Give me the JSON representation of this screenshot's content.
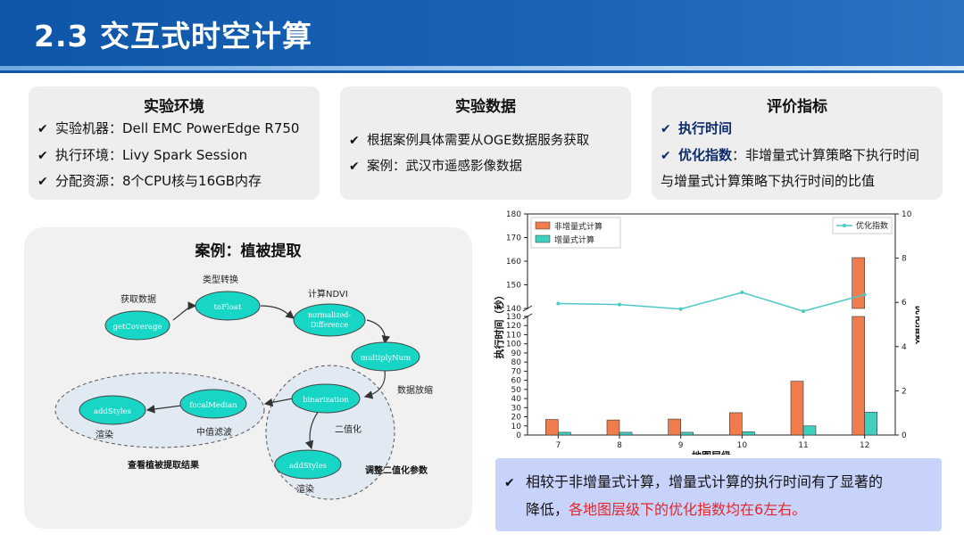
{
  "slide_title": "2.3 交互式时空计算",
  "env": {
    "title": "实验环境",
    "items": [
      "实验机器：Dell EMC PowerEdge R750",
      "执行环境：Livy Spark Session",
      "分配资源：8个CPU核与16GB内存"
    ]
  },
  "data_card": {
    "title": "实验数据",
    "items": [
      "根据案例具体需要从OGE数据服务获取",
      "案例：武汉市遥感影像数据"
    ]
  },
  "metrics": {
    "title": "评价指标",
    "item1": "执行时间",
    "item2_bold": "优化指数",
    "item2_rest": "：非增量式计算策略下执行时间",
    "item2_line2": "与增量式计算策略下执行时间的比值"
  },
  "case": {
    "title": "案例：植被提取",
    "nodes": {
      "getCoverage": "getCoverage",
      "toFloat": "toFloat",
      "nd1": "normalized-",
      "nd2": "Difference",
      "multiplyNum": "multiplyNum",
      "binarization": "binarization",
      "focalMedian": "focalMedian",
      "addStyles1": "addStyles",
      "addStyles2": "addStyles"
    },
    "labels": {
      "get_data": "获取数据",
      "type_convert": "类型转换",
      "ndvi": "计算NDVI",
      "scale": "数据放缩",
      "binarize": "二值化",
      "median": "中值滤波",
      "render1": "渲染",
      "render2": "渲染",
      "view_result": "查看植被提取结果",
      "adjust_param": "调整二值化参数"
    }
  },
  "chart_data": {
    "type": "bar",
    "categories": [
      "7",
      "8",
      "9",
      "10",
      "11",
      "12"
    ],
    "series": [
      {
        "name": "非增量式计算",
        "values": [
          17,
          16.5,
          17.5,
          24.5,
          59,
          161.5
        ],
        "color": "#f07c4d"
      },
      {
        "name": "增量式计算",
        "values": [
          3,
          3,
          3,
          3.5,
          10,
          25
        ],
        "color": "#3fd0c0"
      }
    ],
    "line_series": {
      "name": "优化指数",
      "values": [
        5.95,
        5.9,
        5.7,
        6.45,
        5.6,
        6.35
      ],
      "color": "#4dc9c4",
      "axis": "right"
    },
    "xlabel": "地图层级",
    "ylabel": "执行时间（秒）",
    "y2label": "优化指数",
    "y_ticks_lower": [
      "0",
      "10",
      "20",
      "30",
      "40",
      "50",
      "60",
      "70",
      "80",
      "90",
      "100",
      "110",
      "120",
      "130"
    ],
    "y_ticks_upper": [
      "140",
      "150",
      "160",
      "170",
      "180"
    ],
    "y2_ticks": [
      "0",
      "2",
      "4",
      "6",
      "8",
      "10"
    ],
    "ylim": [
      0,
      180
    ],
    "y_break": [
      130,
      140
    ],
    "y2lim": [
      0,
      10
    ],
    "legend_left": "top-left",
    "legend_right": "top-right"
  },
  "conclusion": {
    "line1": "相较于非增量式计算，增量式计算的执行时间有了显著的",
    "line2_black": "降低，",
    "line2_red": "各地图层级下的优化指数均在6左右。"
  }
}
